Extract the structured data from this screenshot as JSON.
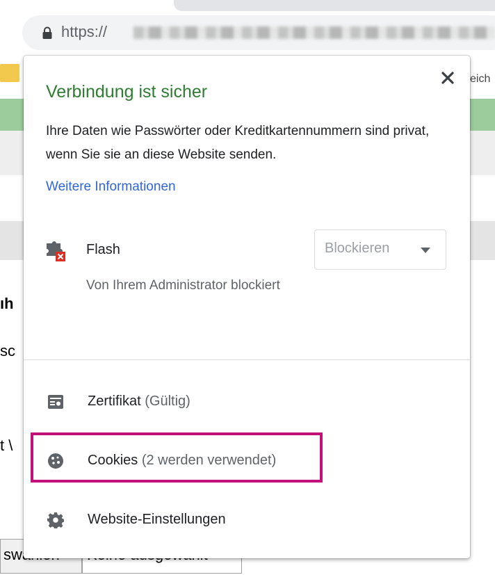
{
  "browser": {
    "url_prefix": "https://",
    "icons": {
      "lock": "lock-icon"
    }
  },
  "page": {
    "bookmark_fragment": "eich",
    "fragments": [
      "ıh",
      "sc",
      "t \\"
    ],
    "buttons": {
      "left": "swählen",
      "right": "Keine ausgewählt"
    }
  },
  "popup": {
    "title": "Verbindung ist sicher",
    "title_color": "#2e7d32",
    "description": "Ihre Daten wie Passwörter oder Kreditkartennummern sind privat, wenn Sie sie an diese Website senden.",
    "more_info_link": "Weitere Informationen",
    "link_color": "#3367d6",
    "close_icon": "close-icon",
    "flash": {
      "name": "Flash",
      "status": "Von Ihrem Administrator blockiert",
      "select_value": "Blockieren",
      "icon": "flash-plugin-blocked-icon"
    },
    "rows": {
      "certificate": {
        "label": "Zertifikat",
        "sub": "(Gültig)",
        "icon": "certificate-icon"
      },
      "cookies": {
        "label": "Cookies",
        "sub": "(2 werden verwendet)",
        "icon": "cookie-icon"
      },
      "settings": {
        "label": "Website-Einstellungen",
        "icon": "gear-icon"
      }
    },
    "highlight_color": "#c2127a"
  }
}
